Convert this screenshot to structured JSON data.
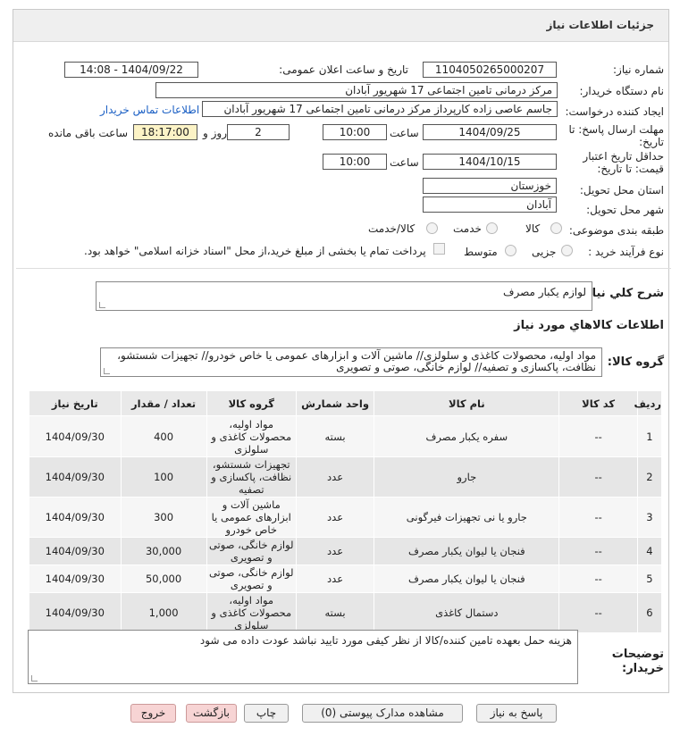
{
  "header": {
    "title": "جزئیات اطلاعات نیاز"
  },
  "fields": {
    "need_number_label": "شماره نیاز:",
    "need_number": "1104050265000207",
    "announce_label": "تاریخ و ساعت اعلان عمومی:",
    "announce_value": "1404/09/22 - 14:08",
    "buyer_label": "نام دستگاه خریدار:",
    "buyer_value": "مرکز درمانی تامین اجتماعی 17 شهریور آبادان",
    "creator_label": "ایجاد کننده درخواست:",
    "creator_value": "جاسم عاصی زاده کارپرداز مرکز درمانی تامین اجتماعی 17 شهریور آبادان",
    "contact_link": "اطلاعات تماس خریدار",
    "deadline_label_1": "مهلت ارسال پاسخ: تا",
    "deadline_label_2": "تاریخ:",
    "deadline_date": "1404/09/25",
    "time_label": "ساعت",
    "deadline_time": "10:00",
    "days_value": "2",
    "days_label": "روز و",
    "remaining_time": "18:17:00",
    "remaining_label": "ساعت باقی مانده",
    "validity_label_1": "حداقل تاریخ اعتبار",
    "validity_label_2": "قیمت: تا تاریخ:",
    "validity_date": "1404/10/15",
    "validity_time": "10:00",
    "province_label": "استان محل تحویل:",
    "province_value": "خوزستان",
    "city_label": "شهر محل تحویل:",
    "city_value": "آبادان",
    "category_label": "طبقه بندی موضوعی:",
    "category_options": [
      "کالا",
      "خدمت",
      "کالا/خدمت"
    ],
    "process_label": "نوع فرآیند خرید :",
    "process_options": [
      "جزیی",
      "متوسط"
    ],
    "payment_text": "پرداخت تمام یا بخشی از مبلغ خرید،از محل \"اسناد خزانه اسلامی\" خواهد بود."
  },
  "summary": {
    "label": "شرح کلي نياز:",
    "value": "لوازم یکبار مصرف"
  },
  "goods_section_title": "اطلاعات کالاهاي مورد نياز",
  "goods_group": {
    "label": "گروه کالا:",
    "value": "مواد اولیه، محصولات کاغذی و سلولزی//  ماشین آلات و ابزارهای عمومی یا خاص خودرو// تجهیزات شستشو، نظافت، پاکسازی و تصفیه// لوازم خانگی، صوتی و تصویری"
  },
  "table": {
    "headers": [
      "ردیف",
      "کد کالا",
      "نام کالا",
      "واحد شمارش",
      "گروه کالا",
      "تعداد / مقدار",
      "تاریخ نیاز"
    ],
    "rows": [
      {
        "idx": "1",
        "code": "--",
        "name": "سفره یکبار مصرف",
        "unit": "بسته",
        "group": "مواد اولیه، محصولات کاغذی و سلولزی",
        "qty": "400",
        "date": "1404/09/30"
      },
      {
        "idx": "2",
        "code": "--",
        "name": "جارو",
        "unit": "عدد",
        "group": "تجهیزات شستشو، نظافت، پاکسازی و تصفیه",
        "qty": "100",
        "date": "1404/09/30"
      },
      {
        "idx": "3",
        "code": "--",
        "name": "جارو یا نی تجهیزات فیرگونی",
        "unit": "عدد",
        "group": "ماشین آلات و ابزارهای عمومی یا خاص خودرو",
        "qty": "300",
        "date": "1404/09/30"
      },
      {
        "idx": "4",
        "code": "--",
        "name": "فنجان یا لیوان یکبار مصرف",
        "unit": "عدد",
        "group": "لوازم خانگی، صوتی و تصویری",
        "qty": "30,000",
        "date": "1404/09/30"
      },
      {
        "idx": "5",
        "code": "--",
        "name": "فنجان یا لیوان یکبار مصرف",
        "unit": "عدد",
        "group": "لوازم خانگی، صوتی و تصویری",
        "qty": "50,000",
        "date": "1404/09/30"
      },
      {
        "idx": "6",
        "code": "--",
        "name": "دستمال کاغذی",
        "unit": "بسته",
        "group": "مواد اولیه، محصولات کاغذی و سلولزی",
        "qty": "1,000",
        "date": "1404/09/30"
      }
    ]
  },
  "buyer_notes": {
    "label_1": "توضیحات",
    "label_2": "خریدار:",
    "value": "هزینه حمل بعهده تامین کننده/کالا از نظر کیفی مورد تایید نباشد عودت داده می شود"
  },
  "buttons": {
    "reply": "پاسخ به نیاز",
    "docs": "مشاهده مدارک پیوستی (0)",
    "print": "چاپ",
    "back": "بازگشت",
    "exit": "خروج"
  },
  "colors": {
    "link": "#1a5fc4",
    "highlight": "#fcf3c6",
    "exit_button": "#f7d4d4"
  }
}
